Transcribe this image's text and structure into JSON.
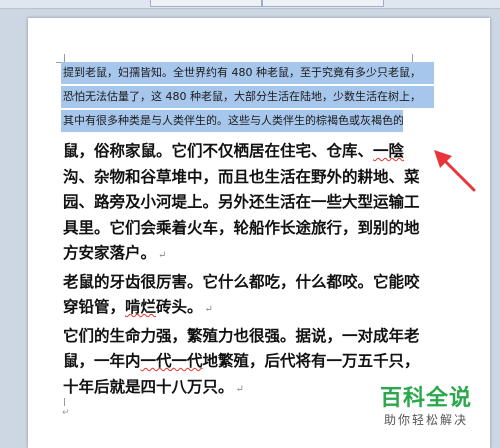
{
  "document": {
    "selected_lines": [
      "提到老鼠，妇孺皆知。全世界约有 480 种老鼠，至于究竟有多少只老鼠，",
      "恐怕无法估量了，这 480 种老鼠，大部分生活在陆地，少数生活在树上，",
      "其中有很多种类是与人类伴生的。这些与人类伴生的棕褐色或灰褐色的老"
    ],
    "paragraph1": {
      "part1": "鼠，俗称家鼠。它们不仅栖居在住宅、仓库、",
      "squiggle_word": "一陰",
      "part2": "沟、杂物和谷草堆中，而且也生活在野外的耕地、菜园、路旁及小河堤上。另外还生活在一些大型运输工具里。它们会乘着火车，轮船作长途旅行，到别的地方安家落户。"
    },
    "paragraph2": {
      "part1": "老鼠的牙齿很厉害。它什么都吃，什么都咬。它能咬穿铅管，",
      "squiggle_word": "啃烂",
      "part2": "砖头。"
    },
    "paragraph3": {
      "part1": "它们的生命力强，繁殖力也很强。据说，一对成年老鼠，一年内",
      "squiggle_word": "一代一代",
      "part2": "地繁殖，后代将有一万五千只，十年后就是四十八万只。"
    },
    "paragraph_mark": "↵"
  },
  "watermark": {
    "title": "百科全说",
    "subtitle": "助你轻松解决"
  },
  "colors": {
    "selection": "#a7c6ec",
    "arrow": "#e8353a",
    "watermark_green": "#2aa84a"
  }
}
